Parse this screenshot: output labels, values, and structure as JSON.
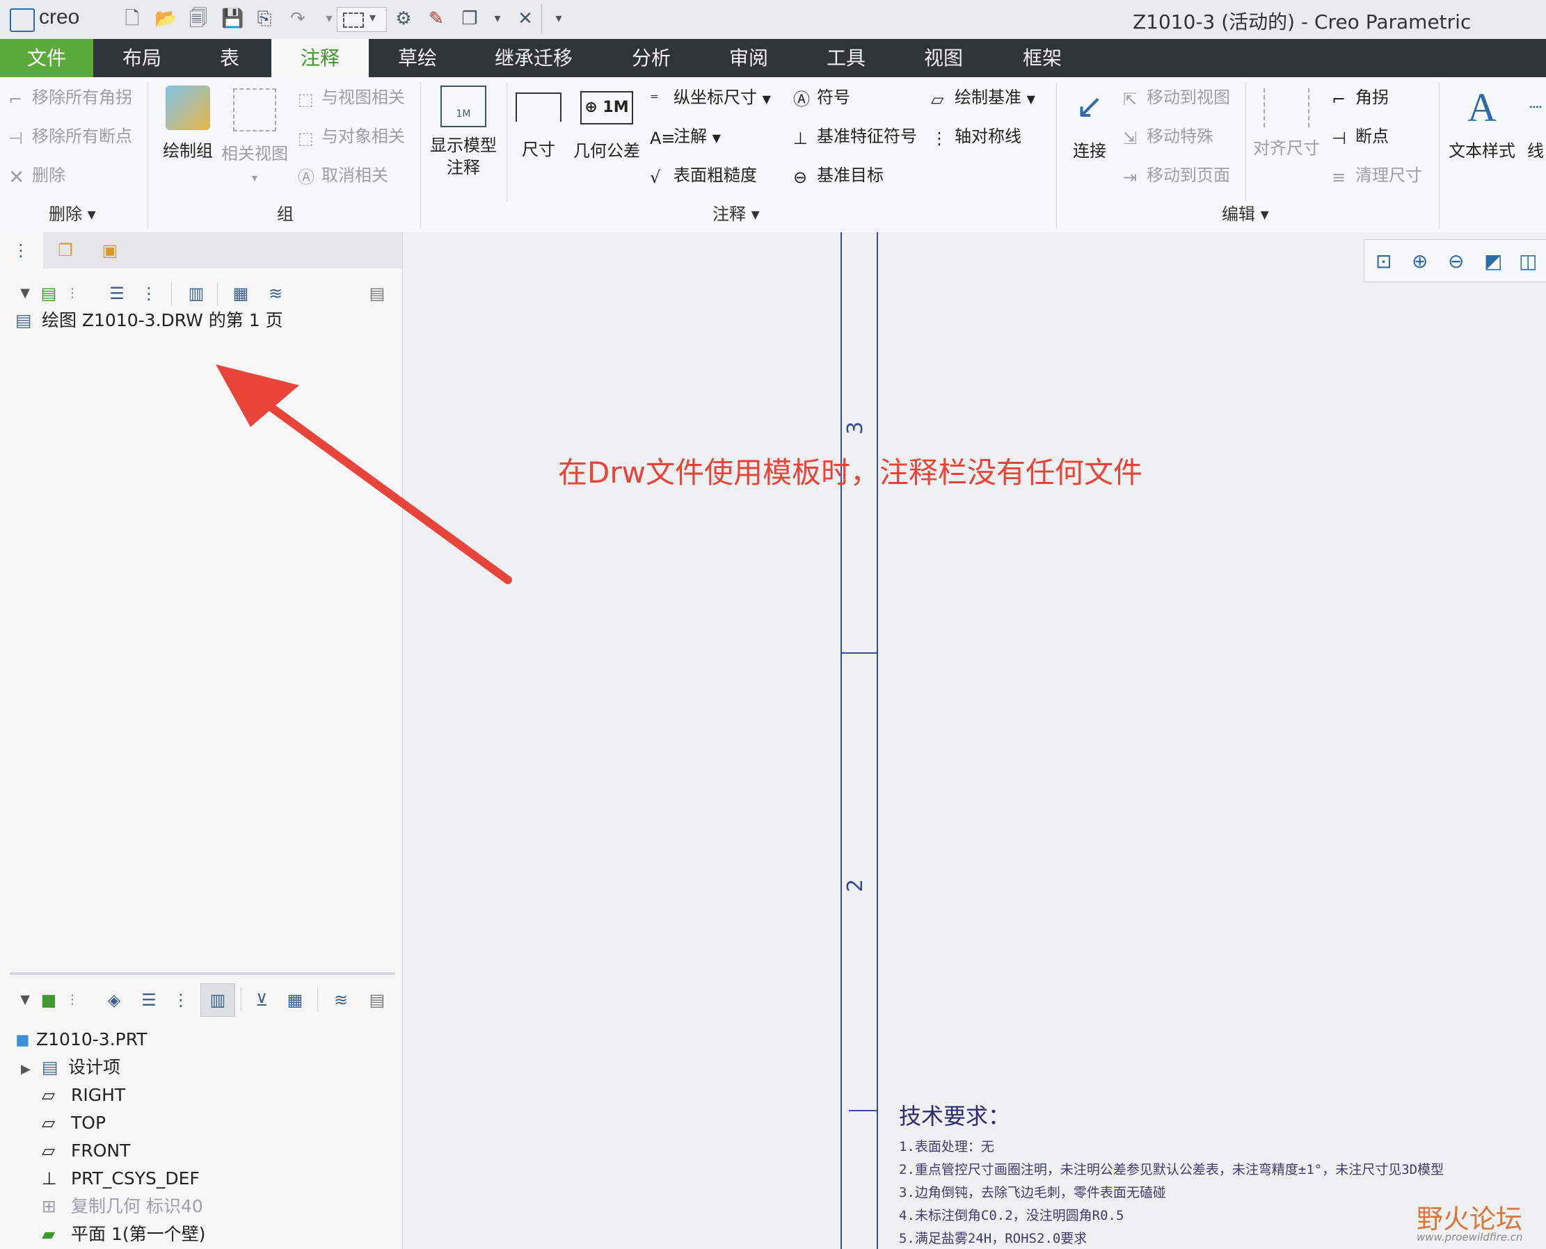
{
  "titlebar": {
    "logo": "creo",
    "title": "Z1010-3 (活动的) - Creo Parametric",
    "quick_access_icons": [
      "new-file-icon",
      "open-folder-icon",
      "open-recent-icon",
      "save-icon",
      "save-copy-icon",
      "redo-icon",
      "select-box-icon",
      "regenerate-icon",
      "model-edit-icon",
      "windows-icon",
      "close-window-icon",
      "customize-icon"
    ]
  },
  "tabs": [
    {
      "label": "文件"
    },
    {
      "label": "布局"
    },
    {
      "label": "表"
    },
    {
      "label": "注释"
    },
    {
      "label": "草绘"
    },
    {
      "label": "继承迁移"
    },
    {
      "label": "分析"
    },
    {
      "label": "审阅"
    },
    {
      "label": "工具"
    },
    {
      "label": "视图"
    },
    {
      "label": "框架"
    }
  ],
  "ribbon": {
    "delete_group": {
      "remove_all_jogs": "移除所有角拐",
      "remove_all_breaks": "移除所有断点",
      "delete": "删除",
      "label": "删除"
    },
    "group_group": {
      "draw_group": "绘制组",
      "related_view": "相关视图",
      "relate_to_view": "与视图相关",
      "relate_to_object": "与对象相关",
      "unrelate": "取消相关",
      "label": "组"
    },
    "annotate_group": {
      "show_model_annotations_1": "显示模型",
      "show_model_annotations_2": "注释",
      "dimension": "尺寸",
      "gtol": "几何公差",
      "ordinate_dim": "纵坐标尺寸",
      "note": "注解",
      "surface_finish": "表面粗糙度",
      "symbol": "符号",
      "datum_feature_symbol": "基准特征符号",
      "datum_target": "基准目标",
      "draw_datum": "绘制基准",
      "centerline": "轴对称线",
      "label": "注释"
    },
    "edit_group": {
      "connect": "连接",
      "move_to_view": "移动到视图",
      "move_special": "移动特殊",
      "move_to_page": "移动到页面",
      "align_dim": "对齐尺寸",
      "jog": "角拐",
      "break": "断点",
      "cleanup_dim": "清理尺寸",
      "label": "编辑"
    },
    "format_group": {
      "text_style": "文本样式",
      "line_partial": "线"
    }
  },
  "left_panel": {
    "drawing_tree_item": "绘图 Z1010-3.DRW 的第 1 页",
    "model_tree": [
      {
        "label": "Z1010-3.PRT",
        "icon": "part-icon",
        "disabled": false
      },
      {
        "label": "设计项",
        "icon": "design-items-icon",
        "disabled": false
      },
      {
        "label": "RIGHT",
        "icon": "datum-plane-icon",
        "disabled": false
      },
      {
        "label": "TOP",
        "icon": "datum-plane-icon",
        "disabled": false
      },
      {
        "label": "FRONT",
        "icon": "datum-plane-icon",
        "disabled": false
      },
      {
        "label": "PRT_CSYS_DEF",
        "icon": "csys-icon",
        "disabled": false
      },
      {
        "label": "复制几何 标识40",
        "icon": "copy-geom-icon",
        "disabled": true
      },
      {
        "label": "平面 1(第一个壁)",
        "icon": "wall-icon",
        "disabled": false
      }
    ]
  },
  "canvas": {
    "annotation_text": "在Drw文件使用模板时，注释栏没有任何文件",
    "annotation_color": "#e8443a",
    "zone_labels": [
      "3",
      "2"
    ],
    "tech_title": "技术要求：",
    "tech_lines": [
      "1.表面处理：无",
      "2.重点管控尺寸画圈注明，未注明公差参见默认公差表，未注弯精度±1°，未注尺寸见3D模型",
      "3.边角倒钝，去除飞边毛刺，零件表面无磕碰",
      "4.未标注倒角C0.2，没注明圆角R0.5",
      "5.满足盐雾24H，ROHS2.0要求"
    ],
    "view_toolbar_icons": [
      "refit-icon",
      "zoom-in-icon",
      "zoom-out-icon",
      "repaint-icon",
      "display-style-icon"
    ]
  },
  "watermark": {
    "text": "野火论坛",
    "url": "www.proewildfire.cn"
  }
}
